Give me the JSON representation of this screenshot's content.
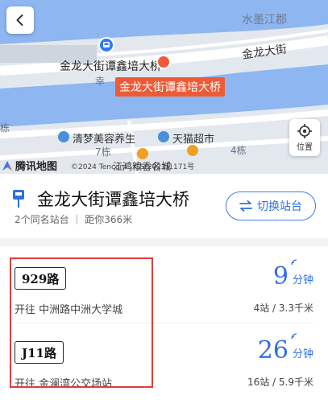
{
  "map": {
    "labels": {
      "district": "水墨江郡",
      "street": "金龙大街",
      "stop_near": "金龙大街谭鑫培大桥",
      "salon": "清梦美容养生",
      "supermarket": "天猫超市",
      "building7": "7栋",
      "building4": "4栋",
      "building_left": "栋",
      "partial_left": "幸",
      "poi_bottom": "江鸿粮香名城"
    },
    "station_tag": "金龙大街谭鑫培大桥",
    "logo_text": "腾讯地图",
    "copyright": "©2024 Tencent - GS(2023)1171号",
    "locate_label": "位置",
    "colors": {
      "water": "#8eb6f0",
      "land": "#e3e8ef",
      "road": "#ffffff",
      "accent": "#ec5b36"
    }
  },
  "stop": {
    "name": "金龙大街谭鑫培大桥",
    "meta": "2个同名站台 ｜ 距你366米",
    "switch_label": "切换站台"
  },
  "lines": [
    {
      "badge": "929路",
      "direction": "开往 中洲路中洲大学城",
      "eta": "9",
      "eta_unit": "分钟",
      "stats": "4站 / 3.3千米"
    },
    {
      "badge": "J11路",
      "direction": "开往 金澜湾公交场站",
      "eta": "26",
      "eta_unit": "分钟",
      "stats": "16站 / 5.9千米"
    }
  ],
  "icons": {
    "back": "back-arrow-icon",
    "locate": "locate-icon",
    "bus_stop": "bus-stop-icon",
    "switch": "swap-icon",
    "signal": "realtime-signal-icon"
  }
}
